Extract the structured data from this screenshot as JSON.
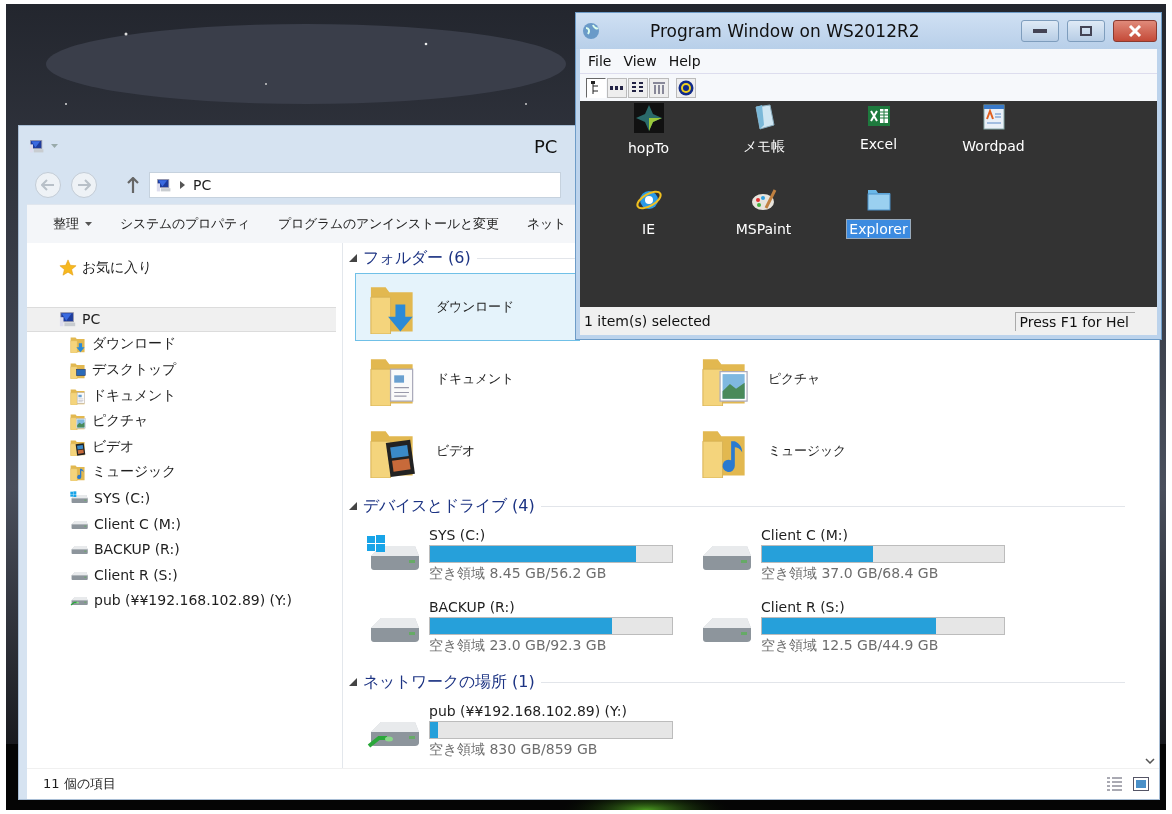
{
  "explorer": {
    "title": "PC",
    "address": "PC",
    "toolbar": [
      {
        "label": "整理",
        "kind": "menu"
      },
      {
        "label": "システムのプロパティ",
        "kind": "plain"
      },
      {
        "label": "プログラムのアンインストールと変更",
        "kind": "plain"
      },
      {
        "label": "ネット",
        "kind": "plain"
      }
    ],
    "nav": [
      {
        "label": "お気に入り",
        "kind": "star",
        "selected": false
      },
      {
        "label": "PC",
        "kind": "pc",
        "selected": true,
        "children": [
          {
            "label": "ダウンロード",
            "kind": "download",
            "selected": false
          },
          {
            "label": "デスクトップ",
            "kind": "desktop",
            "selected": false
          },
          {
            "label": "ドキュメント",
            "kind": "documents",
            "selected": false
          },
          {
            "label": "ピクチャ",
            "kind": "pictures",
            "selected": false
          },
          {
            "label": "ビデオ",
            "kind": "videos",
            "selected": false
          },
          {
            "label": "ミュージック",
            "kind": "music",
            "selected": false
          },
          {
            "label": "SYS (C:)",
            "kind": "windows",
            "selected": false
          },
          {
            "label": "Client C (M:)",
            "kind": "drive",
            "selected": false
          },
          {
            "label": "BACKUP (R:)",
            "kind": "drive",
            "selected": false
          },
          {
            "label": "Client R (S:)",
            "kind": "drive",
            "selected": false
          },
          {
            "label": "pub (¥¥192.168.102.89) (Y:)",
            "kind": "network",
            "selected": false
          }
        ]
      }
    ],
    "groups": [
      {
        "title": "フォルダー (6)",
        "kind": "folders",
        "items": [
          {
            "name": "ダウンロード",
            "kind": "download",
            "selected": true
          },
          {
            "name": "ドキュメント",
            "kind": "documents",
            "selected": false
          },
          {
            "name": "ピクチャ",
            "kind": "pictures",
            "selected": false
          },
          {
            "name": "ビデオ",
            "kind": "videos",
            "selected": false
          },
          {
            "name": "ミュージック",
            "kind": "music",
            "selected": false
          }
        ]
      },
      {
        "title": "デバイスとドライブ (4)",
        "kind": "drives",
        "items": [
          {
            "name": "SYS (C:)",
            "kind": "windows",
            "level": 0.85,
            "free": "空き領域 8.45 GB/56.2 GB"
          },
          {
            "name": "Client C (M:)",
            "kind": "drive",
            "level": 0.46,
            "free": "空き領域 37.0 GB/68.4 GB"
          },
          {
            "name": "BACKUP (R:)",
            "kind": "drive",
            "level": 0.75,
            "free": "空き領域 23.0 GB/92.3 GB"
          },
          {
            "name": "Client R (S:)",
            "kind": "drive",
            "level": 0.72,
            "free": "空き領域 12.5 GB/44.9 GB"
          }
        ]
      },
      {
        "title": "ネットワークの場所 (1)",
        "kind": "drives",
        "items": [
          {
            "name": "pub (¥¥192.168.102.89) (Y:)",
            "kind": "network",
            "level": 0.034,
            "free": "空き領域 830 GB/859 GB"
          }
        ]
      }
    ],
    "status": "11 個の項目"
  },
  "program_window": {
    "title": "Program Window on WS2012R2",
    "menu": [
      "File",
      "View",
      "Help"
    ],
    "toolbar_buttons": [
      {
        "kind": "tree",
        "selected": true
      },
      {
        "kind": "small",
        "selected": false
      },
      {
        "kind": "list",
        "selected": false
      },
      {
        "kind": "details",
        "selected": false
      },
      {
        "kind": "help",
        "selected": false
      }
    ],
    "apps": [
      {
        "label": "hopTo",
        "kind": "hopto",
        "selected": false
      },
      {
        "label": "メモ帳",
        "kind": "notepad",
        "selected": false
      },
      {
        "label": "Excel",
        "kind": "excel",
        "selected": false
      },
      {
        "label": "Wordpad",
        "kind": "wordpad",
        "selected": false
      },
      {
        "label": "IE",
        "kind": "ie",
        "selected": false
      },
      {
        "label": "MSPaint",
        "kind": "paint",
        "selected": false
      },
      {
        "label": "Explorer",
        "kind": "explorer",
        "selected": true
      }
    ],
    "status": "1 item(s) selected",
    "help": "Press F1 for Hel"
  }
}
